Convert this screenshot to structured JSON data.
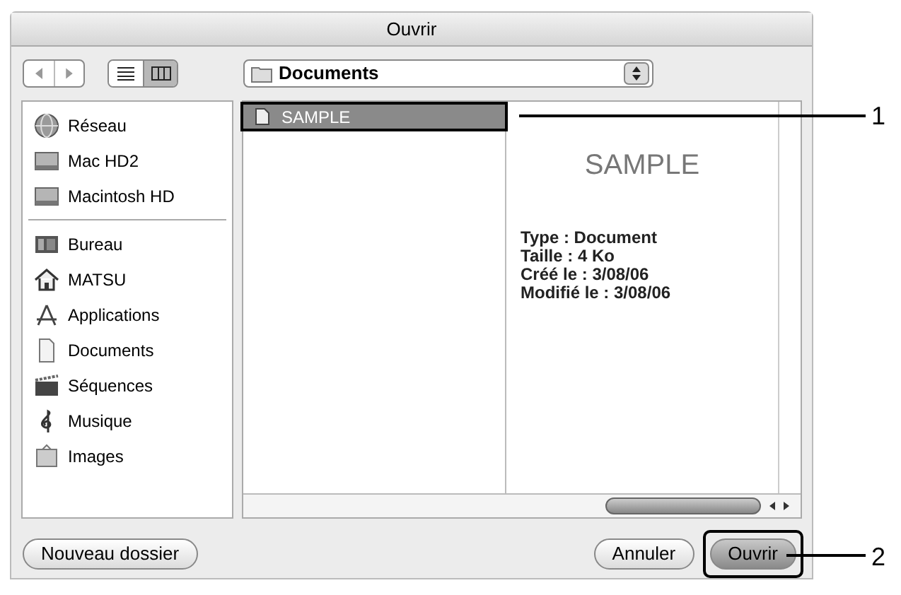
{
  "window": {
    "title": "Ouvrir"
  },
  "toolbar": {
    "view_modes": [
      {
        "kind": "list",
        "selected": false
      },
      {
        "kind": "columns",
        "selected": true
      }
    ],
    "location": "Documents"
  },
  "sidebar": {
    "devices": [
      {
        "label": "Réseau",
        "kind": "network"
      },
      {
        "label": "Mac HD2",
        "kind": "disk"
      },
      {
        "label": "Macintosh HD",
        "kind": "disk"
      }
    ],
    "places": [
      {
        "label": "Bureau",
        "kind": "desktop"
      },
      {
        "label": "MATSU",
        "kind": "home"
      },
      {
        "label": "Applications",
        "kind": "apps"
      },
      {
        "label": "Documents",
        "kind": "documents"
      },
      {
        "label": "Séquences",
        "kind": "movies"
      },
      {
        "label": "Musique",
        "kind": "music"
      },
      {
        "label": "Images",
        "kind": "pictures"
      }
    ]
  },
  "files": [
    {
      "name": "SAMPLE",
      "selected": true
    }
  ],
  "preview": {
    "name": "SAMPLE",
    "details": [
      "Type : Document",
      "Taille : 4 Ko",
      "Créé le : 3/08/06",
      "Modifié le : 3/08/06"
    ]
  },
  "buttons": {
    "new_folder": "Nouveau dossier",
    "cancel": "Annuler",
    "open": "Ouvrir"
  },
  "callouts": [
    "1",
    "2"
  ]
}
